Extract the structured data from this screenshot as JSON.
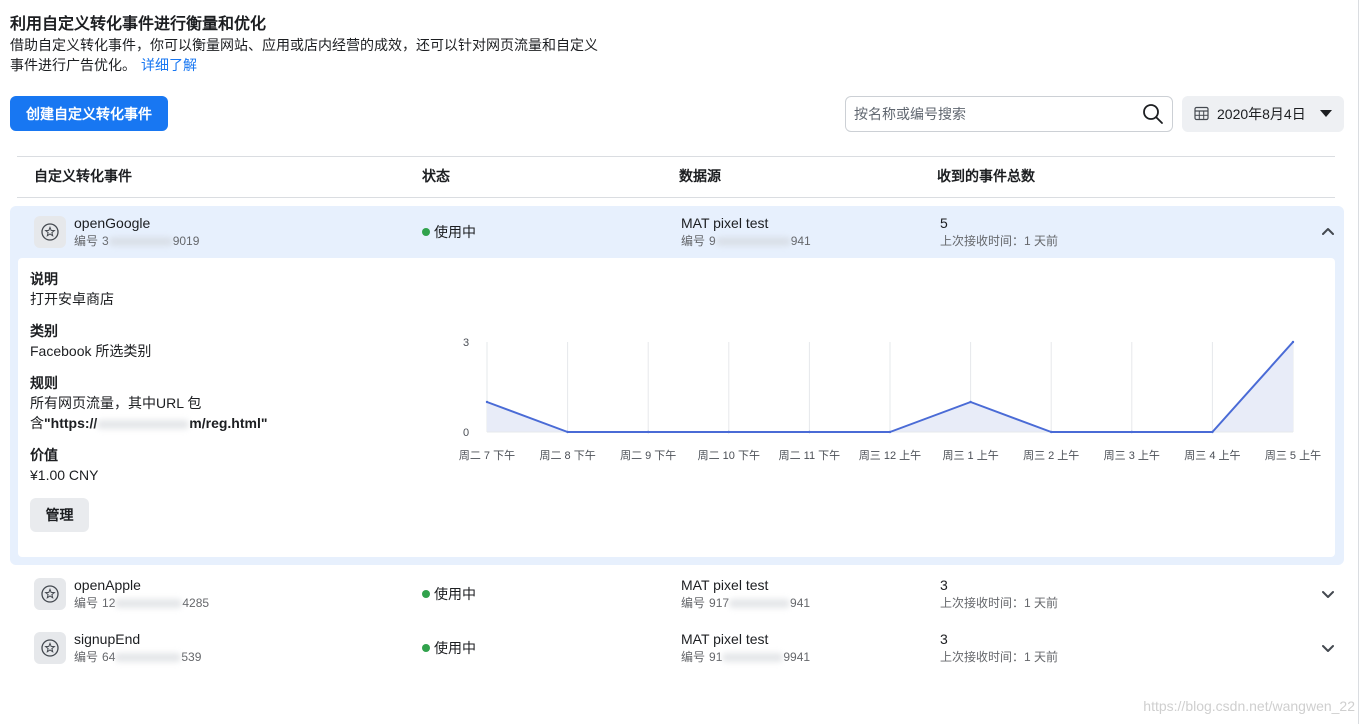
{
  "header": {
    "title": "利用自定义转化事件进行衡量和优化",
    "description_line1": "借助自定义转化事件，你可以衡量网站、应用或店内经营的成效，还可以针对网页流量和自定义",
    "description_line2": "事件进行广告优化。",
    "learn_more": "详细了解"
  },
  "toolbar": {
    "create_label": "创建自定义转化事件",
    "search_placeholder": "按名称或编号搜索",
    "date_label": "2020年8月4日"
  },
  "table": {
    "columns": [
      "自定义转化事件",
      "状态",
      "数据源",
      "收到的事件总数"
    ],
    "id_label": "编号",
    "rows": [
      {
        "name": "openGoogle",
        "id_prefix": "3",
        "id_suffix": "9019",
        "status": "使用中",
        "source": "MAT pixel test",
        "source_id_prefix": "9",
        "source_id_suffix": "941",
        "count": "5",
        "last_received": "上次接收时间：1 天前",
        "expanded": true
      },
      {
        "name": "openApple",
        "id_prefix": "12",
        "id_suffix": "4285",
        "status": "使用中",
        "source": "MAT pixel test",
        "source_id_prefix": "917",
        "source_id_suffix": "941",
        "count": "3",
        "last_received": "上次接收时间：1 天前",
        "expanded": false
      },
      {
        "name": "signupEnd",
        "id_prefix": "64",
        "id_suffix": "539",
        "status": "使用中",
        "source": "MAT pixel test",
        "source_id_prefix": "91",
        "source_id_suffix": "9941",
        "count": "3",
        "last_received": "上次接收时间：1 天前",
        "expanded": false
      }
    ]
  },
  "details": {
    "description_label": "说明",
    "description": "打开安卓商店",
    "category_label": "类别",
    "category": "Facebook 所选类别",
    "rule_label": "规则",
    "rule_line1": "所有网页流量，其中URL 包",
    "rule_line2_prefix": "含",
    "rule_url_prefix": "\"https://",
    "rule_url_suffix": "m/reg.html\"",
    "value_label": "价值",
    "value": "¥1.00 CNY",
    "manage_label": "管理"
  },
  "chart_data": {
    "type": "area",
    "categories": [
      "周二 7 下午",
      "周二 8 下午",
      "周二 9 下午",
      "周二 10 下午",
      "周二 11 下午",
      "周三 12 上午",
      "周三 1 上午",
      "周三 2 上午",
      "周三 3 上午",
      "周三 4 上午",
      "周三 5 上午"
    ],
    "values": [
      1,
      0,
      0,
      0,
      0,
      0,
      1,
      0,
      0,
      0,
      3
    ],
    "yticks": [
      0,
      3
    ],
    "ylim": [
      0,
      3
    ],
    "title": "",
    "xlabel": "",
    "ylabel": "",
    "grid": "vertical",
    "legend": "none"
  },
  "watermark": "https://blog.csdn.net/wangwen_22",
  "icons": {
    "search": "search-icon",
    "date": "calendar-icon",
    "dropdown": "caret-down-icon",
    "row": "star-circle-icon",
    "expanded": "chevron-up-icon",
    "collapsed": "chevron-down-icon"
  },
  "colors": {
    "accent": "#1877f2",
    "status_active": "#31a24c",
    "chart_line": "#4a6bd6",
    "chart_fill": "#e8ecf8",
    "chart_grid": "#e6e8eb",
    "expanded_row": "#e7f0fd"
  }
}
